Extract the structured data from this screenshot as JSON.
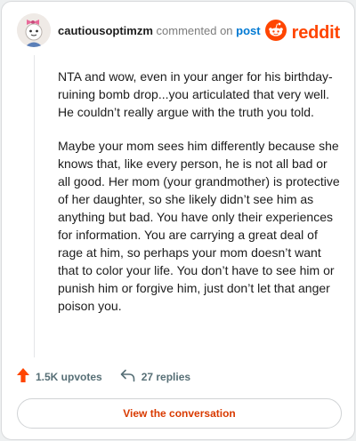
{
  "comment": {
    "username": "cautiousoptimzm",
    "action_text": "commented on",
    "post_link": "post",
    "paragraphs": [
      "NTA and wow, even in your anger for his birthday-ruining bomb drop...you articulated that very well. He couldn’t really argue with the truth you told.",
      "Maybe your mom sees him differently because she knows that, like every person, he is not all bad or all good. Her mom (your grandmother) is protective of her daughter, so she likely didn’t see him as anything but bad. You have only their experiences for information. You are carrying a great deal of rage at him, so perhaps your mom doesn’t want that to color your life. You don’t have to see him or punish him or forgive him, just don’t let that anger poison you."
    ]
  },
  "brand": {
    "name": "reddit",
    "icon": "reddit-logo-icon",
    "color": "#ff4500"
  },
  "actions": {
    "upvotes": "1.5K upvotes",
    "upvote_icon": "upvote-arrow-icon",
    "upvote_color": "#ff4500",
    "replies": "27 replies",
    "reply_icon": "reply-arrow-icon"
  },
  "footer": {
    "view_button": "View the conversation",
    "accent": "#d93a00"
  }
}
